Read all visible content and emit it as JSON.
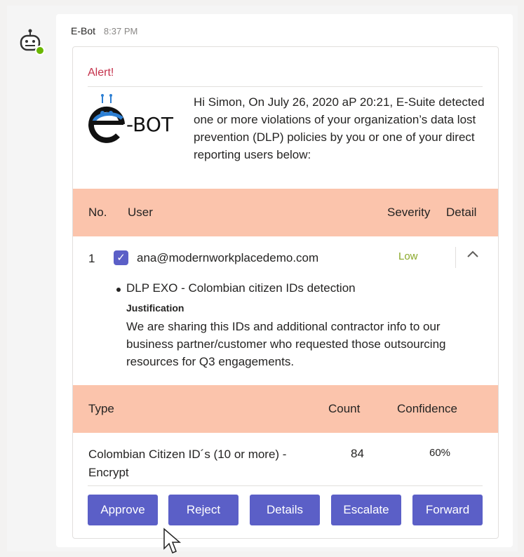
{
  "message": {
    "sender": "E-Bot",
    "time": "8:37 PM"
  },
  "card": {
    "alert_title": "Alert!",
    "logo_text": "-BOT",
    "intro": "Hi Simon, On July 26, 2020 aP 20:21, E-Suite detected one or more violations of your organization’s data lost prevention (DLP) policies by you or one of your direct reporting users below:",
    "users_table": {
      "headers": [
        "No.",
        "User",
        "Severity",
        "Detail"
      ],
      "row": {
        "number": "1",
        "email": "ana@modernworkplacedemo.com",
        "severity": "Low",
        "checked": true,
        "expanded": true,
        "policy": "DLP EXO - Colombian citizen IDs detection",
        "justification_label": "Justification",
        "justification": "We are sharing this IDs and additional contractor info to our business partner/customer who requested those outsourcing resources for Q3 engagements."
      }
    },
    "types_table": {
      "headers": [
        "Type",
        "Count",
        "Confidence"
      ],
      "row": {
        "type": "Colombian Citizen ID´s (10 or more) - Encrypt",
        "count": "84",
        "confidence": "60%"
      }
    },
    "actions": [
      "Approve",
      "Reject",
      "Details",
      "Escalate",
      "Forward"
    ]
  },
  "colors": {
    "accent": "#5b5fc7",
    "alert": "#c4314b",
    "header_band": "#fbc4ac",
    "severity_low": "#8aa829",
    "presence": "#6bb700"
  },
  "icons": {
    "bot_avatar": "robot-avatar-icon",
    "presence": "available-check-icon",
    "checkbox": "checkmark-icon",
    "collapse": "chevron-up-icon",
    "cursor": "mouse-pointer-icon"
  }
}
